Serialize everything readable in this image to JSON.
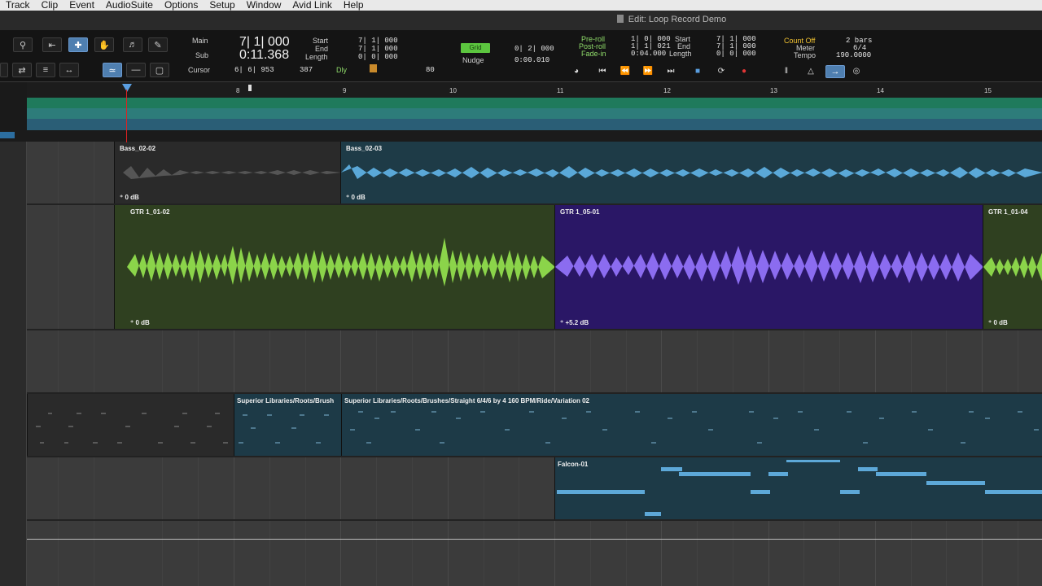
{
  "menu": [
    "Track",
    "Clip",
    "Event",
    "AudioSuite",
    "Options",
    "Setup",
    "Window",
    "Avid Link",
    "Help"
  ],
  "window_title": "Edit: Loop Record Demo",
  "toolbar": {
    "counter": {
      "main_label": "Main",
      "main_value": "7| 1| 000",
      "sub_label": "Sub",
      "sub_value": "0:11.368",
      "cursor_label": "Cursor",
      "cursor_value": "6| 6| 953",
      "cursor_extra": "387",
      "cursor_extra2": "80"
    },
    "selection": {
      "start_label": "Start",
      "end_label": "End",
      "length_label": "Length",
      "start": "7| 1| 000",
      "end": "7| 1| 000",
      "length": "0| 0| 000"
    },
    "grid": {
      "label": "Grid",
      "value": "0| 2| 000",
      "nudge_label": "Nudge",
      "nudge_value": "0:00.010"
    },
    "preroll": {
      "pre_label": "Pre-roll",
      "post_label": "Post-roll",
      "fade_label": "Fade-in",
      "pre": "1| 0| 000",
      "post": "1| 1| 021",
      "fade": "0:04.000"
    },
    "transport_selection": {
      "start_label": "Start",
      "end_label": "End",
      "length_label": "Length",
      "start": "7| 1| 000",
      "end": "7| 1| 000",
      "length": "0| 0| 000"
    },
    "meter": {
      "count_label": "Count Off",
      "count_value": "2 bars",
      "meter_label": "Meter",
      "meter_value": "6/4",
      "tempo_label": "Tempo",
      "tempo_value": "190.0000"
    },
    "dly_label": "Dly"
  },
  "ruler": {
    "bars": [
      "8",
      "9",
      "10",
      "11",
      "12",
      "13",
      "14",
      "15"
    ]
  },
  "tracks": {
    "bass": {
      "clips": [
        {
          "name": "Bass_02-02",
          "gain": "0 dB"
        },
        {
          "name": "Bass_02-03",
          "gain": "0 dB"
        }
      ]
    },
    "gtr": {
      "clips": [
        {
          "name": "GTR 1_01-02",
          "gain": "0 dB"
        },
        {
          "name": "GTR 1_05-01",
          "gain": "+5.2 dB"
        },
        {
          "name": "GTR 1_01-04",
          "gain": "0 dB"
        }
      ]
    },
    "drums": {
      "clips": [
        {
          "name": "Superior Libraries/Roots/Brush"
        },
        {
          "name": "Superior Libraries/Roots/Brushes/Straight 6/4/6 by 4 160 BPM/Ride/Variation 02"
        }
      ]
    },
    "falcon": {
      "clips": [
        {
          "name": "Falcon-01"
        }
      ]
    }
  },
  "colors": {
    "bass_active": "#1e3b47",
    "bass_inactive": "#2a2a2a",
    "gtr_green": "#2f4020",
    "gtr_green_wave": "#8bd44a",
    "gtr_purple": "#2a1766",
    "gtr_purple_wave": "#8b6cf0",
    "midi_clip": "#1d3a47",
    "midi_note": "#5da8d8"
  }
}
